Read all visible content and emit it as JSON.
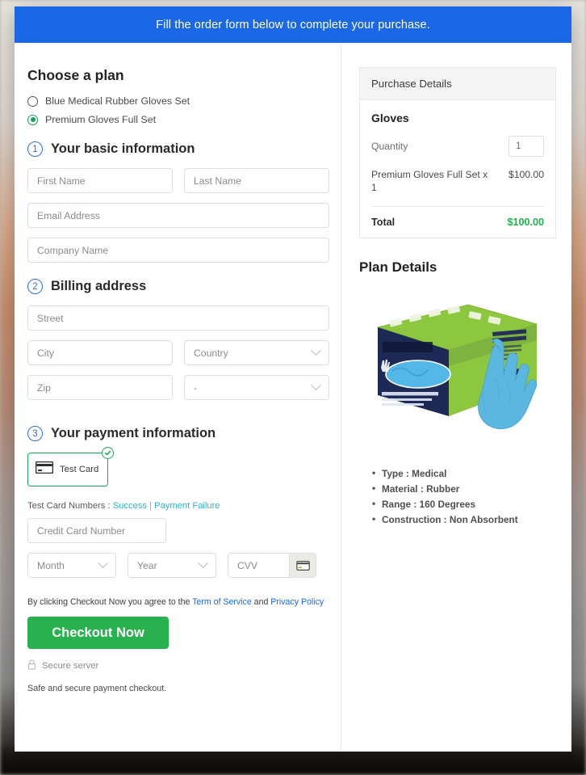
{
  "banner": {
    "text": "Fill the order form below to complete your purchase."
  },
  "plans": {
    "heading": "Choose a plan",
    "options": [
      {
        "label": "Blue Medical Rubber Gloves Set",
        "selected": false
      },
      {
        "label": "Premium Gloves Full Set",
        "selected": true
      }
    ]
  },
  "steps": {
    "basic": {
      "number": "1",
      "title": "Your basic information"
    },
    "billing": {
      "number": "2",
      "title": "Billing address"
    },
    "payment": {
      "number": "3",
      "title": "Your payment information"
    }
  },
  "basic_fields": {
    "first_name": {
      "placeholder": "First Name",
      "value": ""
    },
    "last_name": {
      "placeholder": "Last Name",
      "value": ""
    },
    "email": {
      "placeholder": "Email Address",
      "value": ""
    },
    "company": {
      "placeholder": "Company Name",
      "value": ""
    }
  },
  "billing_fields": {
    "street": {
      "placeholder": "Street",
      "value": ""
    },
    "city": {
      "placeholder": "City",
      "value": ""
    },
    "country": {
      "selected": "Country"
    },
    "zip": {
      "placeholder": "Zip",
      "value": ""
    },
    "state": {
      "selected": "-"
    }
  },
  "payment": {
    "method": {
      "label": "Test Card",
      "selected": true,
      "icon": "credit-card-icon",
      "badge": "check-icon"
    },
    "test_cards": {
      "prefix": "Test Card Numbers : ",
      "success_link": "Success",
      "separator": " | ",
      "failure_link": "Payment Failure"
    },
    "card_number": {
      "placeholder": "Credit Card Number",
      "value": ""
    },
    "month": {
      "selected": "Month"
    },
    "year": {
      "selected": "Year"
    },
    "cvv": {
      "placeholder": "CVV",
      "value": "",
      "icon": "cvv-card-icon"
    }
  },
  "footer": {
    "terms_prefix": "By clicking Checkout Now you agree to the ",
    "terms_link": "Term of Service",
    "terms_mid": " and ",
    "privacy_link": "Privacy Policy",
    "checkout_label": "Checkout Now",
    "secure_label": "Secure server",
    "safe_note": "Safe and secure payment checkout."
  },
  "purchase_details": {
    "header": "Purchase Details",
    "product_group": "Gloves",
    "quantity_label": "Quantity",
    "quantity_value": "1",
    "line_item_name": "Premium Gloves Full Set x 1",
    "line_item_amount": "$100.00",
    "total_label": "Total",
    "total_amount": "$100.00"
  },
  "plan_details": {
    "heading": "Plan Details",
    "image_alt": "nitrile-gloves-box-and-blue-glove",
    "box_text_powder": "POWDER FREE",
    "box_text_latex": "LATEX FREE",
    "box_text_count": "100 PCS",
    "box_text_main": "EXAMINATION NITRILE GLOVES",
    "box_text_es": "GUANTES DE NITRILO PARA EXPLORACIÓN",
    "box_text_fr": "GANTS DE NITRILE POUR EXAMEN",
    "bullets": [
      "Type : Medical",
      "Material : Rubber",
      "Range : 160 Degrees",
      "Construction : Non Absorbent"
    ]
  },
  "colors": {
    "banner_blue": "#1a68e5",
    "accent_green": "#29b04f",
    "step_blue": "#2b6fe0",
    "link_teal": "#27b5c4",
    "link_blue": "#1a68e5",
    "total_green": "#1bb34a"
  }
}
